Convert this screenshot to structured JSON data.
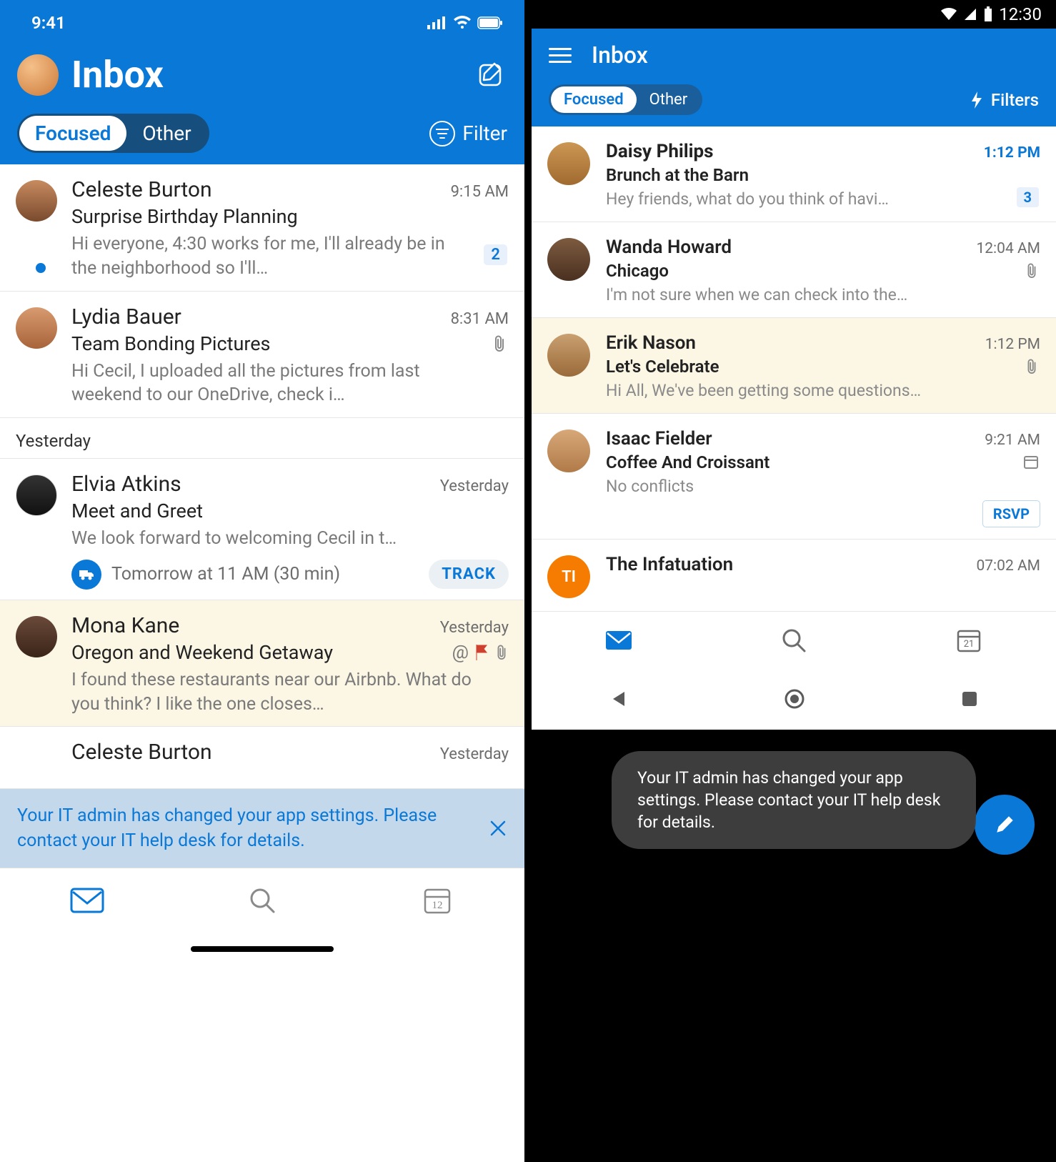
{
  "ios": {
    "status_time": "9:41",
    "title": "Inbox",
    "tabs": {
      "focused": "Focused",
      "other": "Other"
    },
    "filter_label": "Filter",
    "section_yesterday": "Yesterday",
    "track_button": "TRACK",
    "banner_text": "Your IT admin has changed your app settings. Please contact your IT help desk for details.",
    "calendar_date": "12",
    "messages": [
      {
        "from": "Celeste Burton",
        "time": "9:15 AM",
        "subject": "Surprise Birthday Planning",
        "preview": "Hi everyone, 4:30 works for me, I'll already be in the neighborhood so I'll…",
        "badge": "2",
        "unread": true
      },
      {
        "from": "Lydia Bauer",
        "time": "8:31 AM",
        "subject": "Team Bonding Pictures",
        "preview": "Hi Cecil, I uploaded all the pictures from last weekend to our OneDrive, check i…",
        "attachment": true
      },
      {
        "from": "Elvia Atkins",
        "time": "Yesterday",
        "subject": "Meet and Greet",
        "preview": "We look forward to welcoming Cecil in t…",
        "track_note": "Tomorrow at 11 AM (30 min)"
      },
      {
        "from": "Mona Kane",
        "time": "Yesterday",
        "subject": "Oregon and Weekend Getaway",
        "preview": "I found these restaurants near our Airbnb. What do you think? I like the one closes…",
        "mention": true,
        "flag": true,
        "attachment": true,
        "highlight": true
      },
      {
        "from": "Celeste Burton",
        "time": "Yesterday"
      }
    ]
  },
  "android": {
    "status_time": "12:30",
    "title": "Inbox",
    "tabs": {
      "focused": "Focused",
      "other": "Other"
    },
    "filters_label": "Filters",
    "calendar_date": "21",
    "toast_text": "Your IT admin has changed your app settings. Please contact your IT help desk for details.",
    "rsvp_label": "RSVP",
    "messages": [
      {
        "from": "Daisy Philips",
        "time": "1:12 PM",
        "subject": "Brunch at the Barn",
        "preview": "Hey friends, what do you think of havi…",
        "badge": "3",
        "unread": true
      },
      {
        "from": "Wanda Howard",
        "time": "12:04 AM",
        "subject": "Chicago",
        "preview": "I'm not sure when we can check into the…",
        "attachment": true
      },
      {
        "from": "Erik Nason",
        "time": "1:12 PM",
        "subject": "Let's Celebrate",
        "preview": "Hi All, We've been getting some questions…",
        "attachment": true,
        "highlight": true
      },
      {
        "from": "Isaac Fielder",
        "time": "9:21 AM",
        "subject": "Coffee And Croissant",
        "preview": "No conflicts",
        "calendar": true,
        "rsvp": true
      },
      {
        "from": "The Infatuation",
        "time": "07:02 AM",
        "avatar_initials": "TI"
      }
    ]
  }
}
